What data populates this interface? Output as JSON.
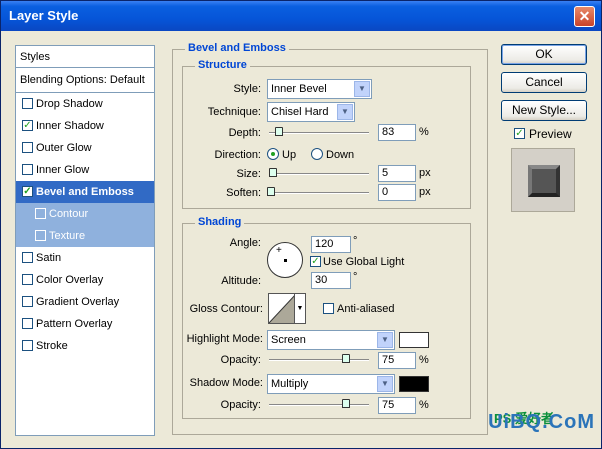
{
  "window": {
    "title": "Layer Style",
    "close_glyph": "✕"
  },
  "styles_list": {
    "header": "Styles",
    "blending": "Blending Options: Default",
    "items": [
      {
        "label": "Drop Shadow",
        "checked": false
      },
      {
        "label": "Inner Shadow",
        "checked": true
      },
      {
        "label": "Outer Glow",
        "checked": false
      },
      {
        "label": "Inner Glow",
        "checked": false
      },
      {
        "label": "Bevel and Emboss",
        "checked": true,
        "selected": true
      },
      {
        "label": "Contour",
        "checked": false,
        "sub": true
      },
      {
        "label": "Texture",
        "checked": false,
        "sub": true
      },
      {
        "label": "Satin",
        "checked": false
      },
      {
        "label": "Color Overlay",
        "checked": false
      },
      {
        "label": "Gradient Overlay",
        "checked": false
      },
      {
        "label": "Pattern Overlay",
        "checked": false
      },
      {
        "label": "Stroke",
        "checked": false
      }
    ]
  },
  "bevel": {
    "title": "Bevel and Emboss",
    "structure": {
      "title": "Structure",
      "style_label": "Style:",
      "style_value": "Inner Bevel",
      "technique_label": "Technique:",
      "technique_value": "Chisel Hard",
      "depth_label": "Depth:",
      "depth_value": "83",
      "depth_unit": "%",
      "depth_level": 0.083,
      "direction_label": "Direction:",
      "dir_up": "Up",
      "dir_down": "Down",
      "direction_selected": "Up",
      "size_label": "Size:",
      "size_value": "5",
      "size_unit": "px",
      "size_level": 0.02,
      "soften_label": "Soften:",
      "soften_value": "0",
      "soften_unit": "px",
      "soften_level": 0
    },
    "shading": {
      "title": "Shading",
      "angle_label": "Angle:",
      "angle_value": "120",
      "angle_unit": "°",
      "use_global": "Use Global Light",
      "use_global_checked": true,
      "altitude_label": "Altitude:",
      "altitude_value": "30",
      "altitude_unit": "°",
      "gloss_label": "Gloss Contour:",
      "anti_aliased": "Anti-aliased",
      "anti_aliased_checked": false,
      "highlight_label": "Highlight Mode:",
      "highlight_mode": "Screen",
      "highlight_color": "#ffffff",
      "hl_opacity_label": "Opacity:",
      "hl_opacity_value": "75",
      "hl_opacity_unit": "%",
      "hl_opacity_level": 0.75,
      "shadow_label": "Shadow Mode:",
      "shadow_mode": "Multiply",
      "shadow_color": "#000000",
      "sh_opacity_label": "Opacity:",
      "sh_opacity_value": "75",
      "sh_opacity_unit": "%",
      "sh_opacity_level": 0.75
    }
  },
  "buttons": {
    "ok": "OK",
    "cancel": "Cancel",
    "new_style": "New Style...",
    "preview": "Preview",
    "preview_checked": true
  },
  "watermark": {
    "text": "UiBQ.CoM",
    "small": "PS 爱好者"
  }
}
